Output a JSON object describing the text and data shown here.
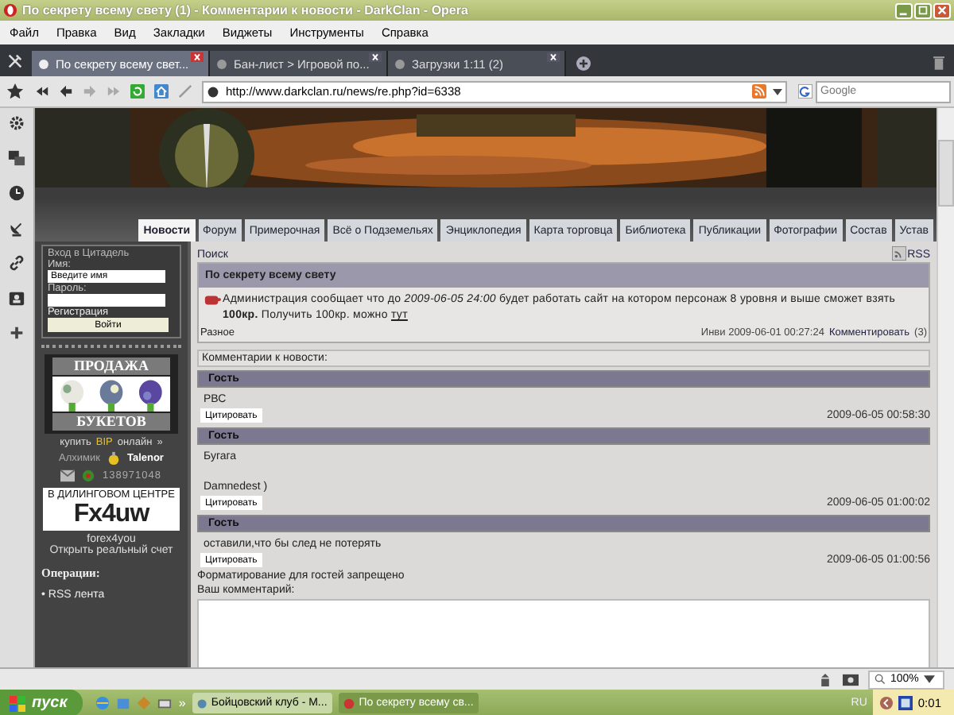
{
  "window": {
    "title": "По секрету всему свету (1) - Комментарии к новости - DarkClan - Opera"
  },
  "menu": [
    "Файл",
    "Правка",
    "Вид",
    "Закладки",
    "Виджеты",
    "Инструменты",
    "Справка"
  ],
  "tabs": [
    {
      "label": "По секрету всему свет...",
      "selected": true
    },
    {
      "label": "Бан-лист > Игровой по...",
      "selected": false
    },
    {
      "label": "Загрузки 1:11 (2)",
      "selected": false
    }
  ],
  "address": {
    "url": "http://www.darkclan.ru/news/re.php?id=6338",
    "search_placeholder": "Google"
  },
  "site": {
    "nav": [
      {
        "label": "Новости",
        "selected": true
      },
      {
        "label": "Форум",
        "selected": false
      },
      {
        "label": "Примерочная",
        "selected": false
      },
      {
        "label": "Всё о Подземельях",
        "selected": false
      },
      {
        "label": "Энциклопедия",
        "selected": false
      },
      {
        "label": "Карта торговца",
        "selected": false
      },
      {
        "label": "Библиотека",
        "selected": false
      },
      {
        "label": "Публикации",
        "selected": false
      },
      {
        "label": "Фотографии",
        "selected": false
      },
      {
        "label": "Состав",
        "selected": false
      },
      {
        "label": "Устав",
        "selected": false
      }
    ],
    "login": {
      "title": "Вход в Цитадель",
      "name_label": "Имя:",
      "name_value": "Введите имя",
      "password_label": "Пароль:",
      "register": "Регистрация",
      "submit": "Войти"
    },
    "flower_ad": {
      "top": "ПРОДАЖА",
      "bottom": "БУКЕТОВ",
      "buy": "купить",
      "currency": "BIP",
      "online": "онлайн",
      "more": "»"
    },
    "profile": {
      "rank": "Алхимик",
      "name": "Talenor",
      "icq": "138971048"
    },
    "forex_ad": {
      "headline": "В ДИЛИНГОВОМ ЦЕНТРЕ",
      "logo": "Fx4uw",
      "name": "forex4you",
      "action": "Открыть реальный счет"
    },
    "operations": {
      "title": "Операции:",
      "items": [
        "• RSS лента"
      ]
    }
  },
  "main": {
    "search_link": "Поиск",
    "rss": "RSS",
    "news": {
      "title": "По секрету всему свету",
      "text": "Администрация сообщает что до *2009-06-05 24:00* будет работать сайт на котором персонаж 8 уровня и выше сможет взять **100кр.** Получить 100кр. можно",
      "link": "тут",
      "category": "Разное",
      "author_date": "Инви 2009-06-01 00:27:24",
      "comment_link": "Комментировать",
      "count": "(3)"
    },
    "comments_title": "Комментарии к новости:",
    "comments": [
      {
        "author": "Гость",
        "lines": [
          "РВС"
        ],
        "quote": "Цитировать",
        "date": "2009-06-05 00:58:30"
      },
      {
        "author": "Гость",
        "lines": [
          "Бугага",
          "Damnedest )"
        ],
        "quote": "Цитировать",
        "date": "2009-06-05 01:00:02"
      },
      {
        "author": "Гость",
        "lines": [
          "оставили,что бы след не потерять"
        ],
        "quote": "Цитировать",
        "date": "2009-06-05 01:00:56"
      }
    ],
    "notice": "Форматирование для гостей запрещено",
    "comment_label": "Ваш комментарий:"
  },
  "status_bar": {
    "zoom": "100%"
  },
  "taskbar": {
    "start": "пуск",
    "more": "»",
    "tasks": [
      {
        "label": "Бойцовский клуб - M...",
        "selected": false
      },
      {
        "label": "По секрету всему св...",
        "selected": true
      }
    ],
    "lang": "RU",
    "clock": "0:01"
  }
}
